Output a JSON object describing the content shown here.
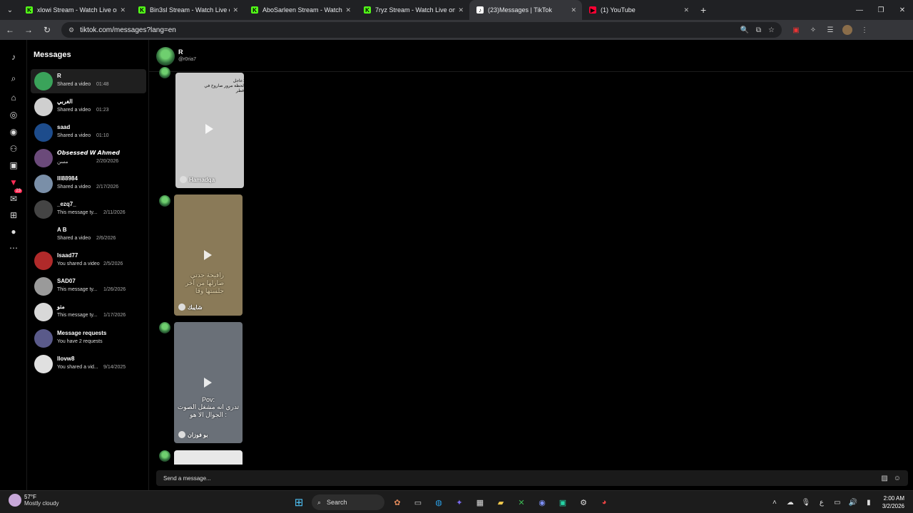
{
  "browser": {
    "tabs": [
      {
        "title": "xlowi Stream - Watch Live on Ki",
        "fav_color": "#53fc18",
        "fav_glyph": "K"
      },
      {
        "title": "Bin3sl Stream - Watch Live on K",
        "fav_color": "#53fc18",
        "fav_glyph": "K"
      },
      {
        "title": "AboSarleen Stream - Watch Live",
        "fav_color": "#53fc18",
        "fav_glyph": "K"
      },
      {
        "title": "7ryz Stream - Watch Live on Ki",
        "fav_color": "#53fc18",
        "fav_glyph": "K"
      },
      {
        "title": "(23)Messages | TikTok",
        "fav_color": "#ffffff",
        "fav_glyph": "♪",
        "active": true
      },
      {
        "title": "(1) YouTube",
        "fav_color": "#ff0033",
        "fav_glyph": "▶"
      }
    ],
    "url": "tiktok.com/messages?lang=en"
  },
  "rail": {
    "notification_count": "23"
  },
  "messages": {
    "heading": "Messages",
    "conversations": [
      {
        "name": "R",
        "preview": "Shared a video",
        "time": "01:48",
        "avatar": "#3aa35a",
        "selected": true
      },
      {
        "name": "الغربي",
        "preview": "Shared a video",
        "time": "01:23",
        "avatar": "#cfcfcf"
      },
      {
        "name": "saad",
        "preview": "Shared a video",
        "time": "01:10",
        "avatar": "#1d4c8c"
      },
      {
        "name": "𝙊𝙗𝙨𝙚𝙨𝙨𝙚𝙙 𝙒 𝘼𝙝𝙢𝙚𝙙",
        "preview": "مسن",
        "time": "2/20/2026",
        "avatar": "#6b4a7a"
      },
      {
        "name": "lll88984",
        "preview": "Shared a video",
        "time": "2/17/2026",
        "avatar": "#7a8fa8"
      },
      {
        "name": "_ezq7_",
        "preview": "This message ty...",
        "time": "2/11/2026",
        "avatar": "#444"
      },
      {
        "name": "A B",
        "preview": "Shared a video",
        "time": "2/6/2026",
        "avatar": "#000"
      },
      {
        "name": "Isaad77",
        "preview": "You shared a video",
        "time": "2/5/2026",
        "avatar": "#b02a2a"
      },
      {
        "name": "SAD07",
        "preview": "This message ty...",
        "time": "1/26/2026",
        "avatar": "#9a9a9a"
      },
      {
        "name": "متو",
        "preview": "This message ty...",
        "time": "1/17/2026",
        "avatar": "#d8d8d8"
      },
      {
        "name": "Message requests",
        "preview": "You have 2 requests",
        "time": "",
        "avatar": "#5a5a8a"
      },
      {
        "name": "llovw8",
        "preview": "You shared a vid...",
        "time": "9/14/2025",
        "avatar": "#e0e0e0"
      }
    ]
  },
  "chat": {
    "name": "R",
    "handle": "@r0ria7",
    "videos": [
      {
        "caption": "عاجل:\nلحظة مرور صاروخ في قطر",
        "watermark": "Hamadqa",
        "bg": "#c9c9c9"
      },
      {
        "caption": "رافيحة جدتي\nصارلها من آخر\nجلستها وقا",
        "watermark": "شايبك",
        "bg": "#8a7a58"
      },
      {
        "caption": "Pov:\nتدري انه مشغل الصوت\nالجوال الا هو :",
        "watermark": "بو فوزان",
        "bg": "#6a7078"
      },
      {
        "caption": "",
        "watermark": "",
        "bg": "#e8e8e8"
      }
    ],
    "composer_placeholder": "Send a message..."
  },
  "taskbar": {
    "temperature": "57°F",
    "condition": "Mostly cloudy",
    "search_label": "Search",
    "time": "2:00 AM",
    "date": "3/2/2026"
  }
}
